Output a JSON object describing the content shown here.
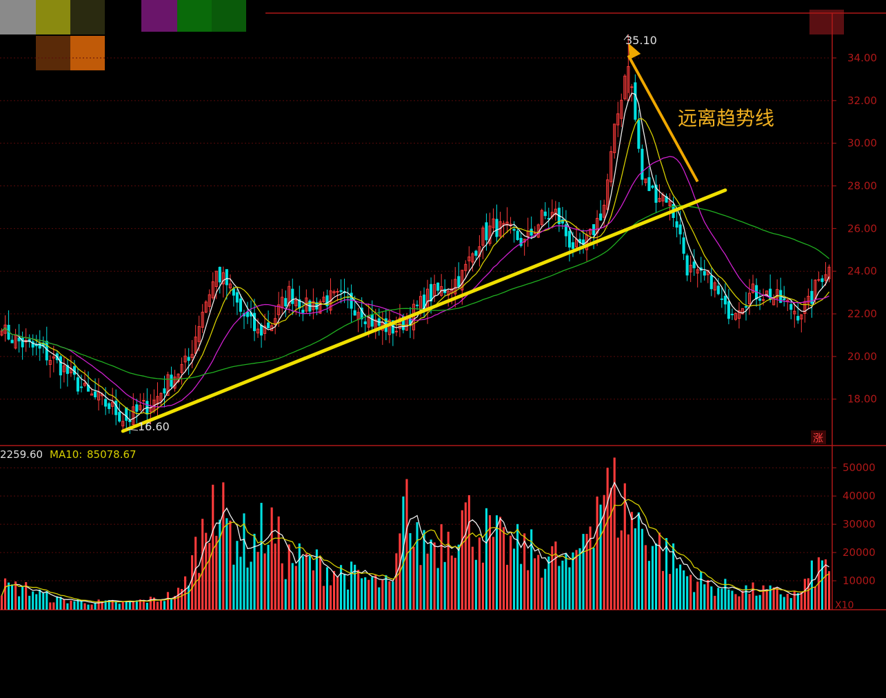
{
  "header": {
    "swatches": [
      "#8a8a8a",
      "#8a8a10",
      "#2a2a10",
      "#6a156a",
      "#0a6a0a",
      "#0a5a0a",
      "#5a2a08",
      "#c05a08",
      "#5a0f12"
    ]
  },
  "volume_header": {
    "volume_value": "2259.60",
    "ma10_label": "MA10:",
    "ma10_value": "85078.67"
  },
  "price_axis_labels": [
    "34.00",
    "32.00",
    "30.00",
    "28.00",
    "26.00",
    "24.00",
    "22.00",
    "20.00",
    "18.00"
  ],
  "volume_axis_labels": [
    "50000",
    "40000",
    "30000",
    "20000",
    "10000"
  ],
  "volume_unit": "X10",
  "rise_badge": "涨",
  "annotations": {
    "high_label": "35.10",
    "low_label": "16.60",
    "trend_note": "远离趋势线"
  },
  "colors": {
    "up": "#ff3b3b",
    "down": "#00e0e0",
    "ma_white": "#f0f0f0",
    "ma_yellow": "#d8d000",
    "ma_magenta": "#d020d0",
    "ma_green": "#20b020",
    "trendline": "#f0e000",
    "arrow": "#f0a800",
    "axis_red": "#b01818",
    "grid_red": "#5a0a0a"
  },
  "chart_data": {
    "type": "candlestick",
    "price_ylim": [
      15.8,
      35.6
    ],
    "volume_ylim": [
      0,
      52000
    ],
    "high_point": 35.1,
    "low_point": 16.6,
    "close_anchors": [
      [
        0,
        21.2
      ],
      [
        6,
        20.6
      ],
      [
        12,
        20.2
      ],
      [
        18,
        19.4
      ],
      [
        25,
        18.2
      ],
      [
        31,
        17.7
      ],
      [
        36,
        17.0
      ],
      [
        40,
        17.5
      ],
      [
        44,
        17.9
      ],
      [
        49,
        19.0
      ],
      [
        54,
        19.8
      ],
      [
        58,
        22.2
      ],
      [
        62,
        23.9
      ],
      [
        65,
        23.4
      ],
      [
        69,
        22.1
      ],
      [
        74,
        21.1
      ],
      [
        78,
        21.6
      ],
      [
        83,
        23.0
      ],
      [
        88,
        22.3
      ],
      [
        93,
        22.7
      ],
      [
        98,
        22.7
      ],
      [
        103,
        22.3
      ],
      [
        108,
        21.5
      ],
      [
        114,
        21.3
      ],
      [
        118,
        21.9
      ],
      [
        123,
        22.8
      ],
      [
        128,
        23.2
      ],
      [
        133,
        23.8
      ],
      [
        138,
        25.5
      ],
      [
        142,
        26.1
      ],
      [
        147,
        25.8
      ],
      [
        151,
        25.3
      ],
      [
        156,
        26.5
      ],
      [
        160,
        26.7
      ],
      [
        164,
        25.4
      ],
      [
        167,
        24.9
      ],
      [
        170,
        25.6
      ],
      [
        174,
        27.1
      ],
      [
        177,
        30.5
      ],
      [
        180,
        33.2
      ],
      [
        182,
        32.5
      ],
      [
        185,
        28.3
      ],
      [
        188,
        27.7
      ],
      [
        192,
        27.5
      ],
      [
        195,
        26.3
      ],
      [
        198,
        24.2
      ],
      [
        201,
        23.7
      ],
      [
        205,
        23.6
      ],
      [
        209,
        22.1
      ],
      [
        213,
        22.5
      ],
      [
        217,
        23.0
      ],
      [
        222,
        22.9
      ],
      [
        226,
        22.5
      ],
      [
        230,
        22.1
      ],
      [
        233,
        22.4
      ],
      [
        236,
        23.6
      ],
      [
        238,
        24.1
      ]
    ],
    "volume_anchors": [
      [
        0,
        8000
      ],
      [
        8,
        7000
      ],
      [
        15,
        3500
      ],
      [
        25,
        2500
      ],
      [
        35,
        2200
      ],
      [
        45,
        3500
      ],
      [
        52,
        6000
      ],
      [
        56,
        20000
      ],
      [
        61,
        36000
      ],
      [
        66,
        28000
      ],
      [
        72,
        22000
      ],
      [
        77,
        30000
      ],
      [
        82,
        18000
      ],
      [
        90,
        16000
      ],
      [
        98,
        13000
      ],
      [
        106,
        10000
      ],
      [
        113,
        8000
      ],
      [
        116,
        30000
      ],
      [
        120,
        22000
      ],
      [
        126,
        25000
      ],
      [
        133,
        33000
      ],
      [
        138,
        28000
      ],
      [
        145,
        22000
      ],
      [
        152,
        20000
      ],
      [
        160,
        18000
      ],
      [
        165,
        14000
      ],
      [
        170,
        35000
      ],
      [
        174,
        45000
      ],
      [
        178,
        38000
      ],
      [
        182,
        32000
      ],
      [
        190,
        22000
      ],
      [
        198,
        12000
      ],
      [
        205,
        8000
      ],
      [
        213,
        7000
      ],
      [
        222,
        6000
      ],
      [
        230,
        5000
      ],
      [
        234,
        12000
      ],
      [
        238,
        16000
      ]
    ],
    "moving_averages": [
      {
        "period": 5,
        "color": "#f0f0f0",
        "target": "price"
      },
      {
        "period": 10,
        "color": "#d8d000",
        "target": "price"
      },
      {
        "period": 20,
        "color": "#d020d0",
        "target": "price"
      },
      {
        "period": 60,
        "color": "#20b020",
        "target": "price"
      },
      {
        "period": 5,
        "color": "#f0f0f0",
        "target": "volume"
      },
      {
        "period": 10,
        "color": "#d8d000",
        "target": "volume"
      }
    ],
    "trendline": {
      "from": [
        35,
        16.5
      ],
      "to": [
        209,
        27.8
      ]
    },
    "arrow": {
      "from": [
        201,
        28.2
      ],
      "to": [
        181,
        34.7
      ]
    },
    "legend": "none",
    "grid": true
  }
}
